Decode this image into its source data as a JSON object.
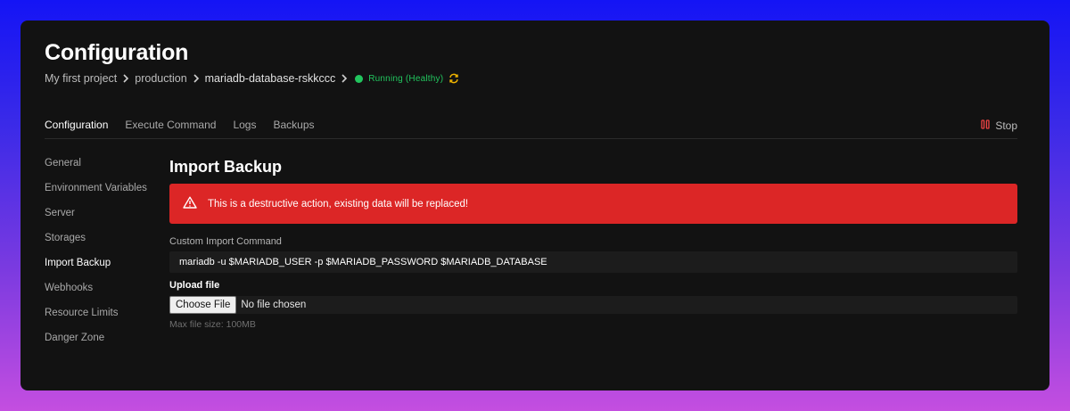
{
  "header": {
    "title": "Configuration",
    "breadcrumb": [
      "My first project",
      "production",
      "mariadb-database-rskkccc"
    ],
    "status": "Running (Healthy)"
  },
  "tabs": [
    {
      "label": "Configuration",
      "active": true
    },
    {
      "label": "Execute Command",
      "active": false
    },
    {
      "label": "Logs",
      "active": false
    },
    {
      "label": "Backups",
      "active": false
    }
  ],
  "stop": {
    "label": "Stop"
  },
  "sidebar": {
    "items": [
      {
        "label": "General"
      },
      {
        "label": "Environment Variables"
      },
      {
        "label": "Server"
      },
      {
        "label": "Storages"
      },
      {
        "label": "Import Backup",
        "active": true
      },
      {
        "label": "Webhooks"
      },
      {
        "label": "Resource Limits"
      },
      {
        "label": "Danger Zone"
      }
    ]
  },
  "main": {
    "title": "Import Backup",
    "alert": "This is a destructive action, existing data will be replaced!",
    "command_label": "Custom Import Command",
    "command_value": "mariadb -u $MARIADB_USER -p $MARIADB_PASSWORD $MARIADB_DATABASE",
    "upload_label": "Upload file",
    "choose_file": "Choose File",
    "file_status": "No file chosen",
    "hint": "Max file size: 100MB"
  },
  "colors": {
    "accent_danger": "#dc2626",
    "status_healthy": "#22c55e",
    "restart_icon": "#f0b400"
  }
}
